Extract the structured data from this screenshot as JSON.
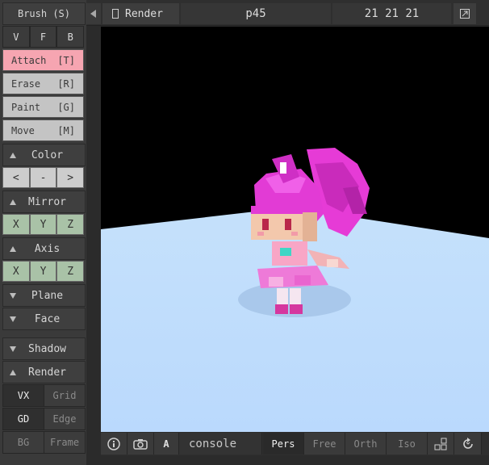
{
  "left_panel": {
    "brush_label": "Brush (S)",
    "modes": [
      "V",
      "F",
      "B"
    ],
    "tools": [
      {
        "name": "Attach",
        "key": "[T]"
      },
      {
        "name": "Erase",
        "key": "[R]"
      },
      {
        "name": "Paint",
        "key": "[G]"
      },
      {
        "name": "Move",
        "key": "[M]"
      }
    ],
    "sections": {
      "color": "Color",
      "mirror": "Mirror",
      "axis": "Axis",
      "plane": "Plane",
      "face": "Face",
      "shadow": "Shadow",
      "render": "Render"
    },
    "color_buttons": [
      "<",
      "-",
      ">"
    ],
    "mirror_axes": [
      "X",
      "Y",
      "Z"
    ],
    "axis_axes": [
      "X",
      "Y",
      "Z"
    ],
    "render_buttons": [
      [
        "VX",
        "Grid"
      ],
      [
        "GD",
        "Edge"
      ],
      [
        "BG",
        "Frame"
      ]
    ]
  },
  "top_bar": {
    "render_label": "Render",
    "file_name": "p45",
    "size": "21 21 21"
  },
  "bottom_bar": {
    "font_label": "A",
    "console_label": "console",
    "views": [
      "Pers",
      "Free",
      "Orth",
      "Iso"
    ],
    "active_view": "Pers"
  },
  "icons": {
    "info": "info-icon",
    "camera": "camera-icon",
    "layout": "layout-icon",
    "reset": "reset-view-icon",
    "maximize": "maximize-icon",
    "collapse": "collapse-arrow-icon"
  },
  "colors": {
    "attach_active": "#f6a5b1",
    "floor": "#bcdcfd",
    "character": "#e63bd6"
  }
}
